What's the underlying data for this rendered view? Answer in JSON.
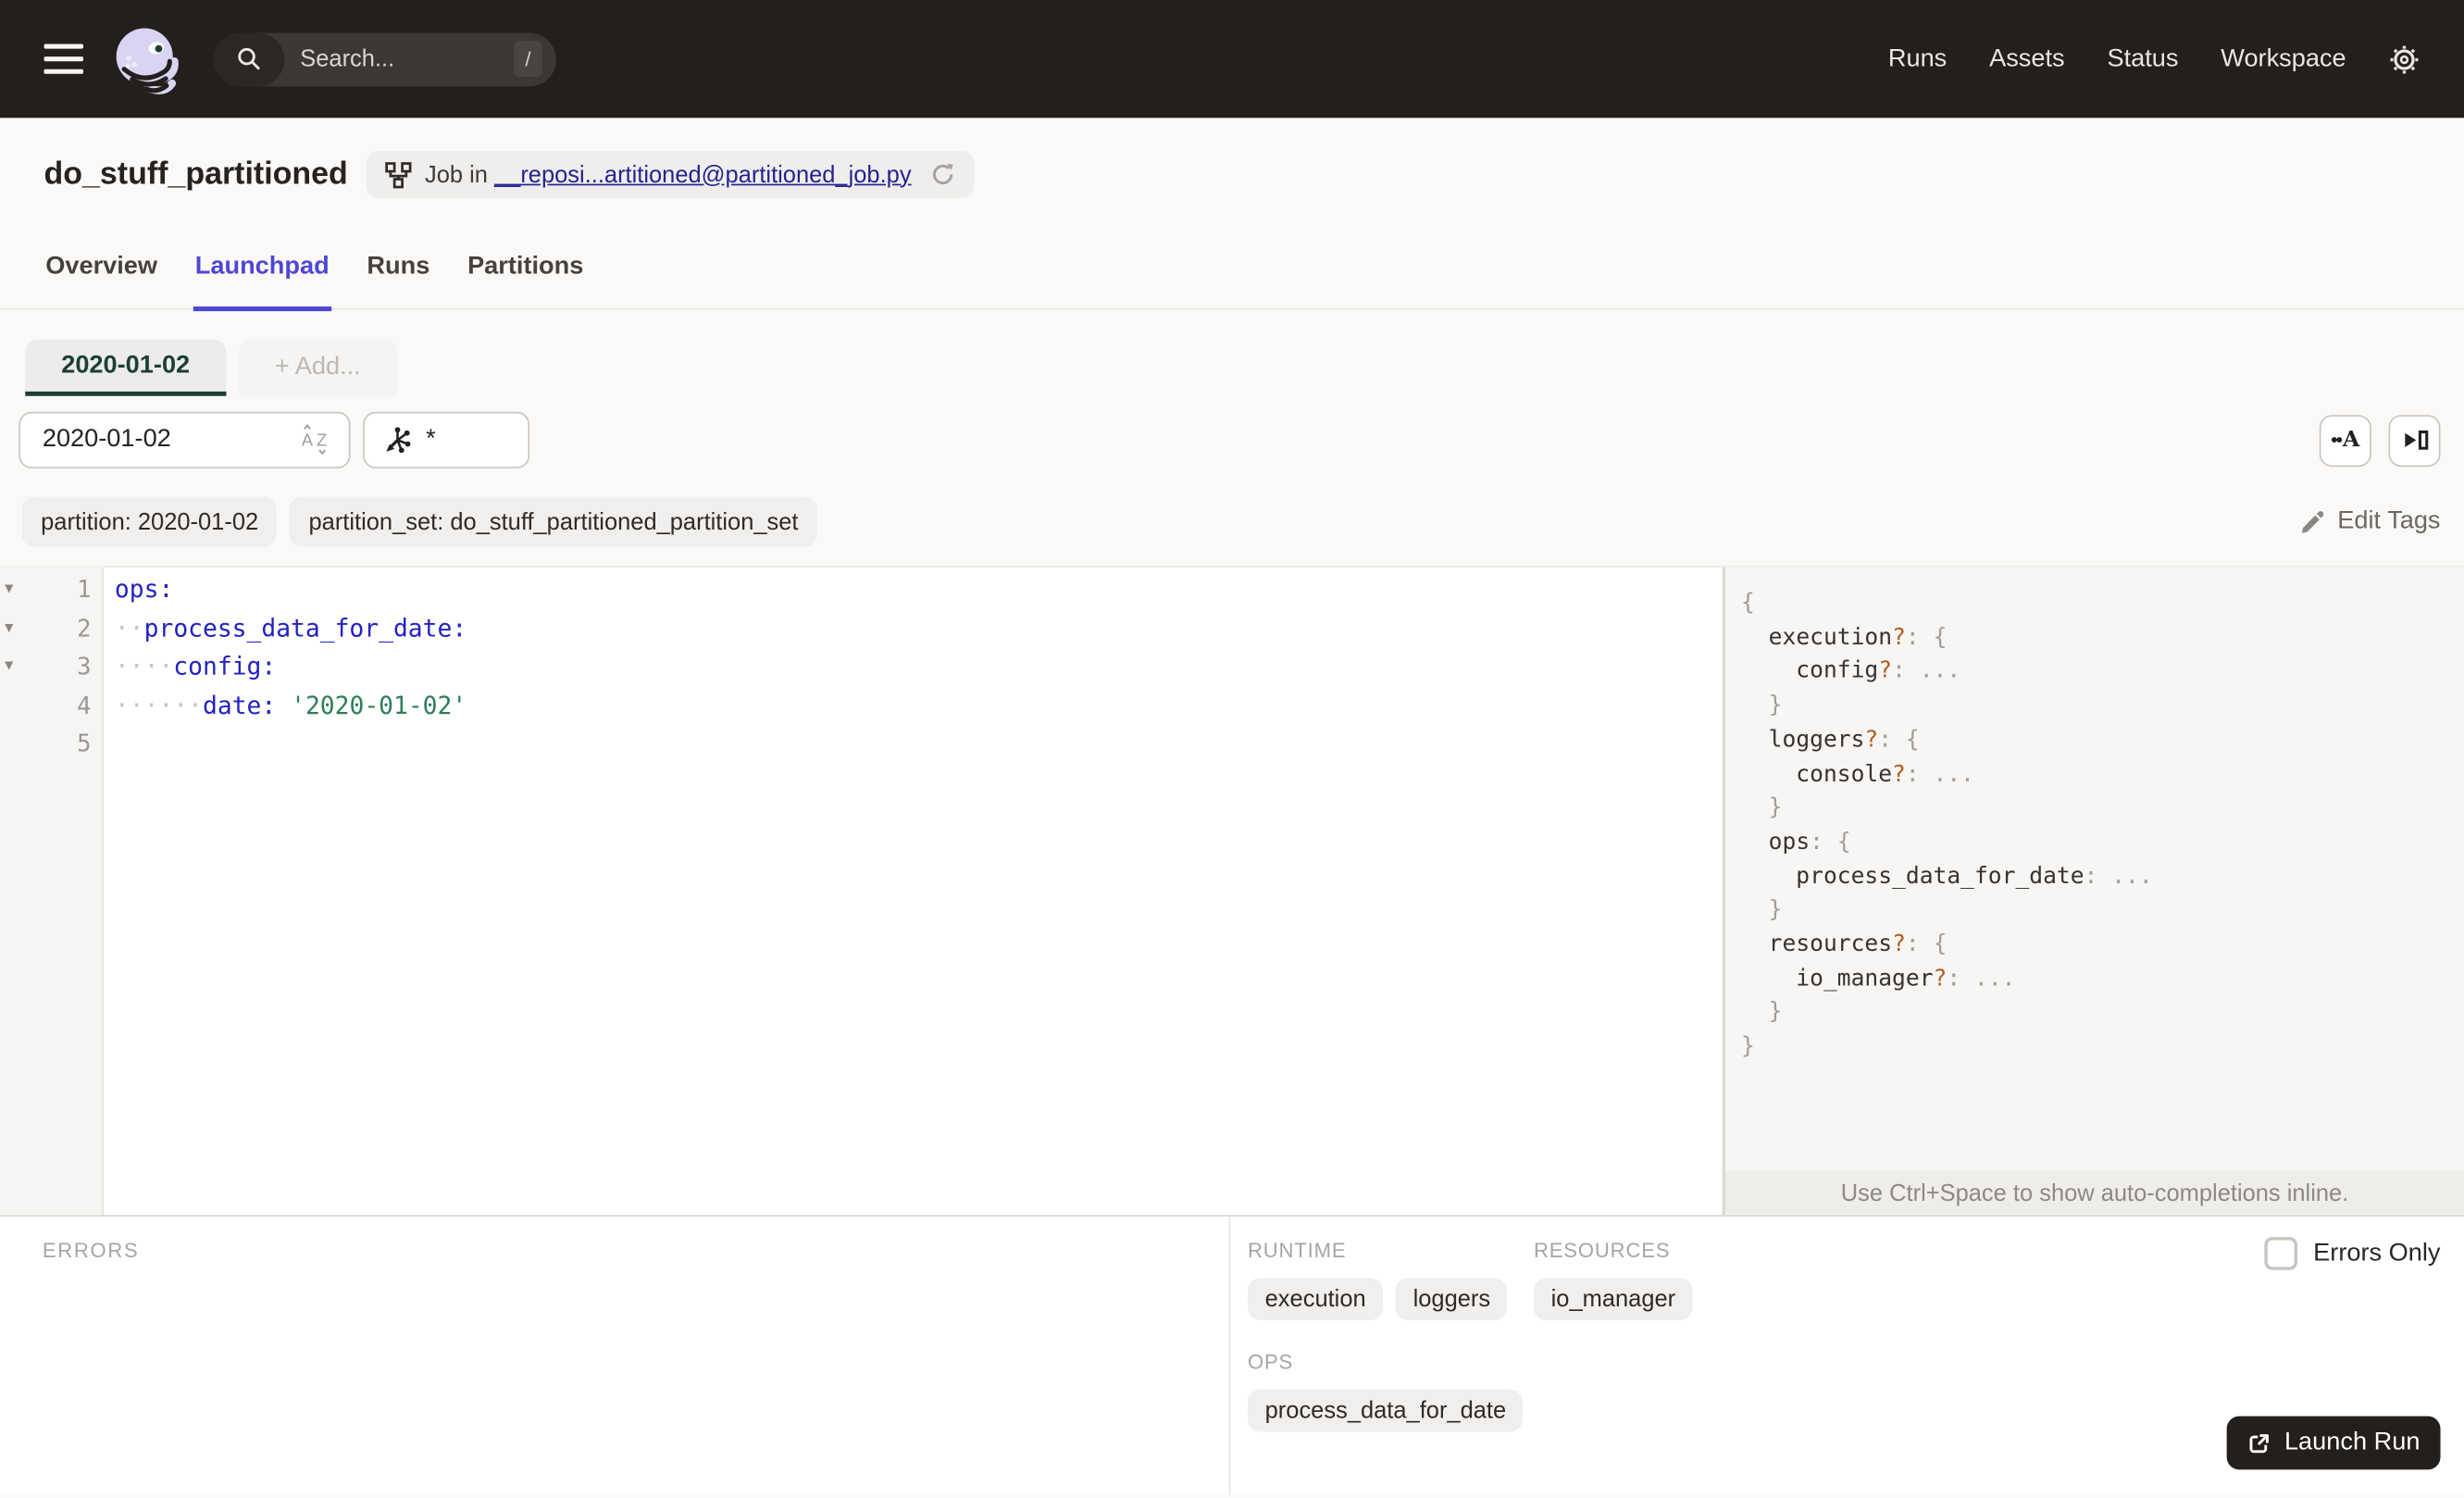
{
  "header": {
    "search_placeholder": "Search...",
    "search_shortcut": "/",
    "nav_items": [
      "Runs",
      "Assets",
      "Status",
      "Workspace"
    ]
  },
  "page": {
    "title": "do_stuff_partitioned",
    "job_badge": {
      "prefix": "Job in",
      "link": "__reposi...artitioned@partitioned_job.py"
    }
  },
  "tabs": [
    {
      "label": "Overview",
      "active": false
    },
    {
      "label": "Launchpad",
      "active": true
    },
    {
      "label": "Runs",
      "active": false
    },
    {
      "label": "Partitions",
      "active": false
    }
  ],
  "partition_tabs": {
    "active_label": "2020-01-02",
    "add_label": "+ Add..."
  },
  "controls": {
    "partition_input": "2020-01-02",
    "op_selector_input": "*"
  },
  "tags": [
    "partition: 2020-01-02",
    "partition_set: do_stuff_partitioned_partition_set"
  ],
  "edit_tags_label": "Edit Tags",
  "editor": {
    "lines": [
      {
        "num": 1,
        "fold": true,
        "tokens": [
          {
            "t": "ops:",
            "c": "key"
          }
        ]
      },
      {
        "num": 2,
        "fold": true,
        "tokens": [
          {
            "t": "··",
            "c": "ws"
          },
          {
            "t": "process_data_for_date:",
            "c": "key"
          }
        ]
      },
      {
        "num": 3,
        "fold": true,
        "tokens": [
          {
            "t": "····",
            "c": "ws"
          },
          {
            "t": "config:",
            "c": "key"
          }
        ]
      },
      {
        "num": 4,
        "fold": false,
        "tokens": [
          {
            "t": "······",
            "c": "ws"
          },
          {
            "t": "date:",
            "c": "key"
          },
          {
            "t": " ",
            "c": "plain"
          },
          {
            "t": "'2020-01-02'",
            "c": "str"
          }
        ]
      },
      {
        "num": 5,
        "fold": false,
        "tokens": []
      }
    ]
  },
  "schema": {
    "lines": [
      {
        "indent": 0,
        "tokens": [
          {
            "t": "{",
            "c": "p"
          }
        ]
      },
      {
        "indent": 1,
        "tokens": [
          {
            "t": "execution",
            "c": "k"
          },
          {
            "t": "?",
            "c": "q"
          },
          {
            "t": ": ",
            "c": "p"
          },
          {
            "t": "{",
            "c": "p"
          }
        ]
      },
      {
        "indent": 2,
        "tokens": [
          {
            "t": "config",
            "c": "k"
          },
          {
            "t": "?",
            "c": "q"
          },
          {
            "t": ": ",
            "c": "p"
          },
          {
            "t": "...",
            "c": "p"
          }
        ]
      },
      {
        "indent": 1,
        "tokens": [
          {
            "t": "}",
            "c": "p"
          }
        ]
      },
      {
        "indent": 1,
        "tokens": [
          {
            "t": "loggers",
            "c": "k"
          },
          {
            "t": "?",
            "c": "q"
          },
          {
            "t": ": ",
            "c": "p"
          },
          {
            "t": "{",
            "c": "p"
          }
        ]
      },
      {
        "indent": 2,
        "tokens": [
          {
            "t": "console",
            "c": "k"
          },
          {
            "t": "?",
            "c": "q"
          },
          {
            "t": ": ",
            "c": "p"
          },
          {
            "t": "...",
            "c": "p"
          }
        ]
      },
      {
        "indent": 1,
        "tokens": [
          {
            "t": "}",
            "c": "p"
          }
        ]
      },
      {
        "indent": 1,
        "tokens": [
          {
            "t": "ops",
            "c": "k"
          },
          {
            "t": ": ",
            "c": "p"
          },
          {
            "t": "{",
            "c": "p"
          }
        ]
      },
      {
        "indent": 2,
        "tokens": [
          {
            "t": "process_data_for_date",
            "c": "k"
          },
          {
            "t": ": ",
            "c": "p"
          },
          {
            "t": "...",
            "c": "p"
          }
        ]
      },
      {
        "indent": 1,
        "tokens": [
          {
            "t": "}",
            "c": "p"
          }
        ]
      },
      {
        "indent": 1,
        "tokens": [
          {
            "t": "resources",
            "c": "k"
          },
          {
            "t": "?",
            "c": "q"
          },
          {
            "t": ": ",
            "c": "p"
          },
          {
            "t": "{",
            "c": "p"
          }
        ]
      },
      {
        "indent": 2,
        "tokens": [
          {
            "t": "io_manager",
            "c": "k"
          },
          {
            "t": "?",
            "c": "q"
          },
          {
            "t": ": ",
            "c": "p"
          },
          {
            "t": "...",
            "c": "p"
          }
        ]
      },
      {
        "indent": 1,
        "tokens": [
          {
            "t": "}",
            "c": "p"
          }
        ]
      },
      {
        "indent": 0,
        "tokens": [
          {
            "t": "}",
            "c": "p"
          }
        ]
      }
    ],
    "hint": "Use Ctrl+Space to show auto-completions inline."
  },
  "bottom": {
    "errors_label": "ERRORS",
    "errors_only_label": "Errors Only",
    "sections": {
      "runtime": {
        "label": "RUNTIME",
        "chips": [
          "execution",
          "loggers"
        ]
      },
      "resources": {
        "label": "RESOURCES",
        "chips": [
          "io_manager"
        ]
      },
      "ops": {
        "label": "OPS",
        "chips": [
          "process_data_for_date"
        ]
      }
    },
    "launch_label": "Launch Run"
  },
  "colors": {
    "header_bg": "#231F1C",
    "accent_blue": "#4F46D6",
    "accent_green": "#1B4035",
    "link_navy": "#24238F",
    "code_key_blue": "#2322C2",
    "code_string_green": "#2D7E57",
    "schema_qmark_orange": "#B05C20"
  }
}
